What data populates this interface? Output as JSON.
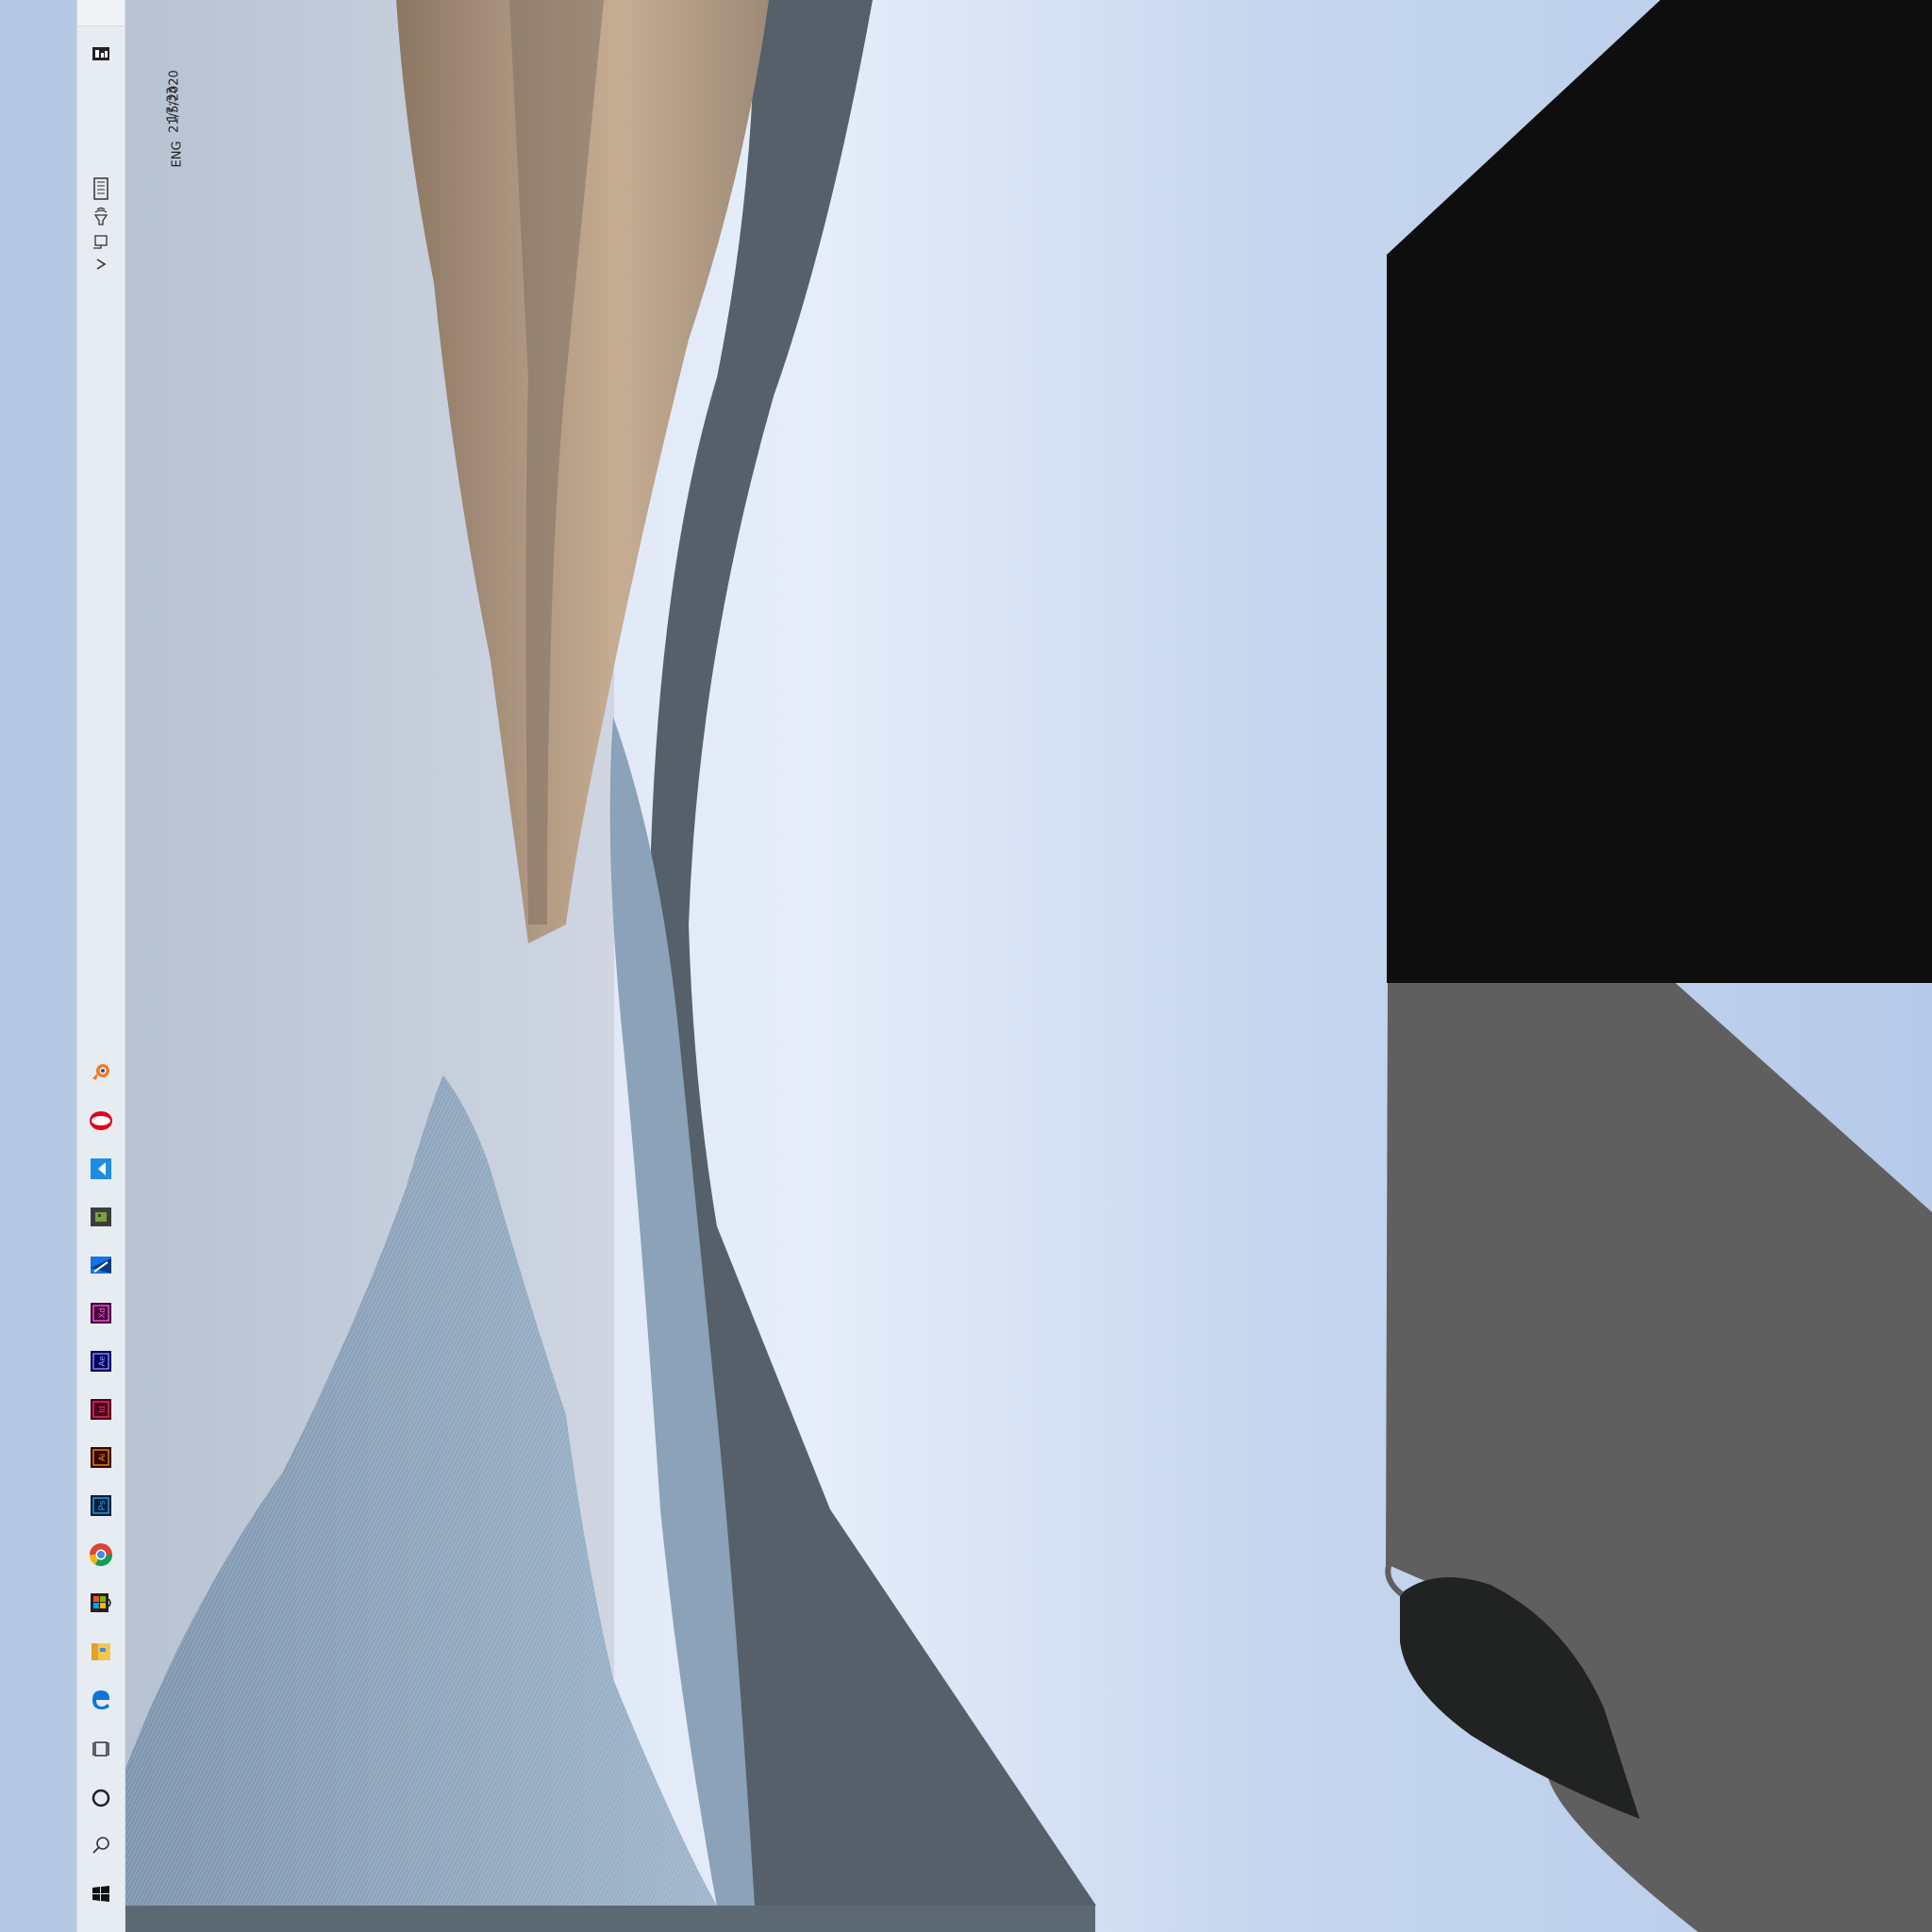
{
  "taskbar": {
    "clock": {
      "date": "21/5/2020",
      "time": "17:33"
    },
    "language": "ENG",
    "tray_icons": [
      "notification-icon",
      "keyboard-icon",
      "volume-icon",
      "network-icon",
      "chevron-up-icon"
    ],
    "pinned_apps": [
      {
        "name": "windows-start-icon"
      },
      {
        "name": "search-icon"
      },
      {
        "name": "cortana-icon"
      },
      {
        "name": "task-view-icon"
      },
      {
        "name": "edge-icon"
      },
      {
        "name": "file-explorer-icon"
      },
      {
        "name": "microsoft-store-icon"
      },
      {
        "name": "chrome-icon"
      },
      {
        "name": "photoshop-icon",
        "label": "Ps"
      },
      {
        "name": "illustrator-icon",
        "label": "Ai"
      },
      {
        "name": "indesign-icon",
        "label": "Id"
      },
      {
        "name": "after-effects-icon",
        "label": "Ae"
      },
      {
        "name": "adobe-xd-icon",
        "label": "Xd"
      },
      {
        "name": "media-encoder-icon"
      },
      {
        "name": "minecraft-icon"
      },
      {
        "name": "kite-icon"
      },
      {
        "name": "opera-icon"
      },
      {
        "name": "blender-icon"
      }
    ]
  },
  "colors": {
    "taskbar_bg": "#e7ecf3",
    "sky_light": "#e6eefa",
    "sky_dark": "#b9cdea",
    "dark_overlay": "#0e0e0e",
    "grey_overlay": "#5f5f5f",
    "ps_blue": "#31a8ff",
    "ai_orange": "#ff9a00",
    "id_pink": "#ff3366",
    "xd_pink": "#ff61f6",
    "ae_purple": "#9999ff"
  }
}
